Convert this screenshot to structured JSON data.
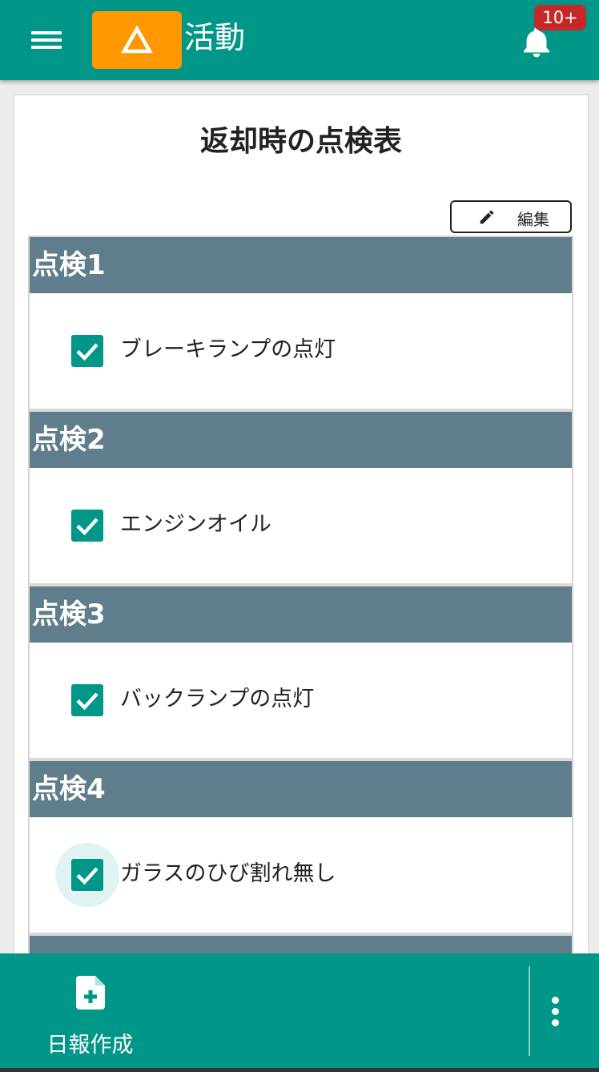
{
  "header": {
    "title": "活動",
    "notification_badge": "10+",
    "brand_color": "#009688",
    "logo_color": "#ff9800"
  },
  "card": {
    "title": "返却時の点検表",
    "edit_label": "編集"
  },
  "checklist": [
    {
      "header": "点検1",
      "item": "ブレーキランプの点灯",
      "checked": true
    },
    {
      "header": "点検2",
      "item": "エンジンオイル",
      "checked": true
    },
    {
      "header": "点検3",
      "item": "バックランプの点灯",
      "checked": true
    },
    {
      "header": "点検4",
      "item": "ガラスのひび割れ無し",
      "checked": true
    }
  ],
  "bottom_bar": {
    "report_label": "日報作成"
  }
}
